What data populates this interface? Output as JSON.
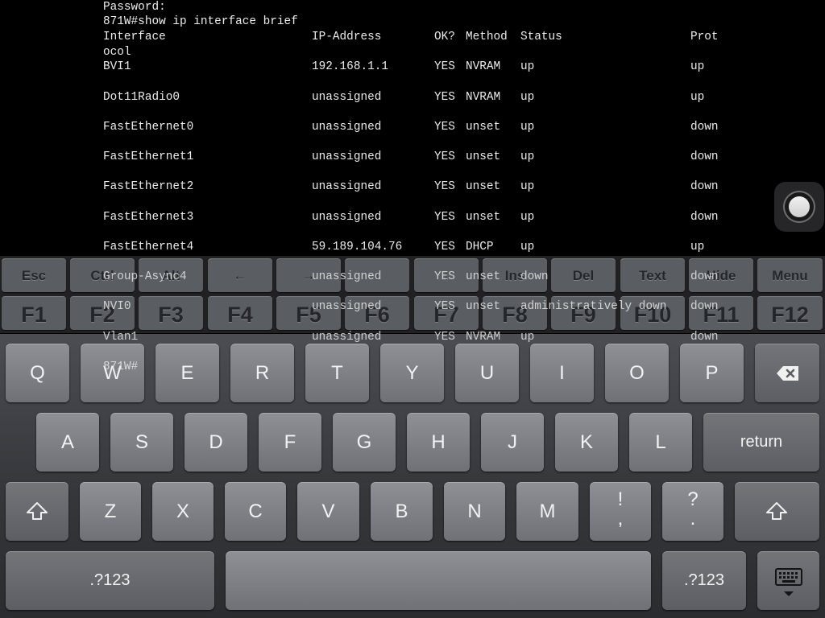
{
  "terminal": {
    "header_lines": [
      "Password:",
      "871W#show ip interface brief"
    ],
    "columns": [
      "Interface",
      "IP-Address",
      "OK?",
      "Method",
      "Status",
      "Prot"
    ],
    "columns_wrap": "ocol",
    "rows": [
      {
        "interface": "BVI1",
        "ip": "192.168.1.1",
        "ok": "YES",
        "method": "NVRAM",
        "status": "up",
        "protocol": "up"
      },
      {
        "interface": "Dot11Radio0",
        "ip": "unassigned",
        "ok": "YES",
        "method": "NVRAM",
        "status": "up",
        "protocol": "up"
      },
      {
        "interface": "FastEthernet0",
        "ip": "unassigned",
        "ok": "YES",
        "method": "unset",
        "status": "up",
        "protocol": "down"
      },
      {
        "interface": "FastEthernet1",
        "ip": "unassigned",
        "ok": "YES",
        "method": "unset",
        "status": "up",
        "protocol": "down"
      },
      {
        "interface": "FastEthernet2",
        "ip": "unassigned",
        "ok": "YES",
        "method": "unset",
        "status": "up",
        "protocol": "down"
      },
      {
        "interface": "FastEthernet3",
        "ip": "unassigned",
        "ok": "YES",
        "method": "unset",
        "status": "up",
        "protocol": "down"
      },
      {
        "interface": "FastEthernet4",
        "ip": "59.189.104.76",
        "ok": "YES",
        "method": "DHCP",
        "status": "up",
        "protocol": "up"
      },
      {
        "interface": "Group-Async4",
        "ip": "unassigned",
        "ok": "YES",
        "method": "unset",
        "status": "down",
        "protocol": "down"
      },
      {
        "interface": "NVI0",
        "ip": "unassigned",
        "ok": "YES",
        "method": "unset",
        "status": "administratively down",
        "protocol": "down"
      },
      {
        "interface": "Vlan1",
        "ip": "unassigned",
        "ok": "YES",
        "method": "NVRAM",
        "status": "up",
        "protocol": "down"
      }
    ],
    "prompt": "871W#"
  },
  "fkey_bar": {
    "top_row": [
      "Esc",
      "Ctrl",
      "Alt",
      "←",
      "→",
      "↑",
      "↓",
      "Ins",
      "Del",
      "Text",
      "Hide",
      "Menu"
    ],
    "bottom_row": [
      "F1",
      "F2",
      "F3",
      "F4",
      "F5",
      "F6",
      "F7",
      "F8",
      "F9",
      "F10",
      "F11",
      "F12"
    ]
  },
  "keyboard": {
    "row1": [
      "Q",
      "W",
      "E",
      "R",
      "T",
      "Y",
      "U",
      "I",
      "O",
      "P"
    ],
    "row2": [
      "A",
      "S",
      "D",
      "F",
      "G",
      "H",
      "J",
      "K",
      "L"
    ],
    "return_label": "return",
    "row3": [
      "Z",
      "X",
      "C",
      "V",
      "B",
      "N",
      "M"
    ],
    "punct1": {
      "top": "!",
      "bottom": ","
    },
    "punct2": {
      "top": "?",
      "bottom": "."
    },
    "numbers_label": ".?123"
  },
  "icons": {
    "backspace": "backspace-icon",
    "shift": "shift-icon",
    "hide_keyboard": "hide-keyboard-icon",
    "assistive_touch": "assistive-touch-icon"
  }
}
